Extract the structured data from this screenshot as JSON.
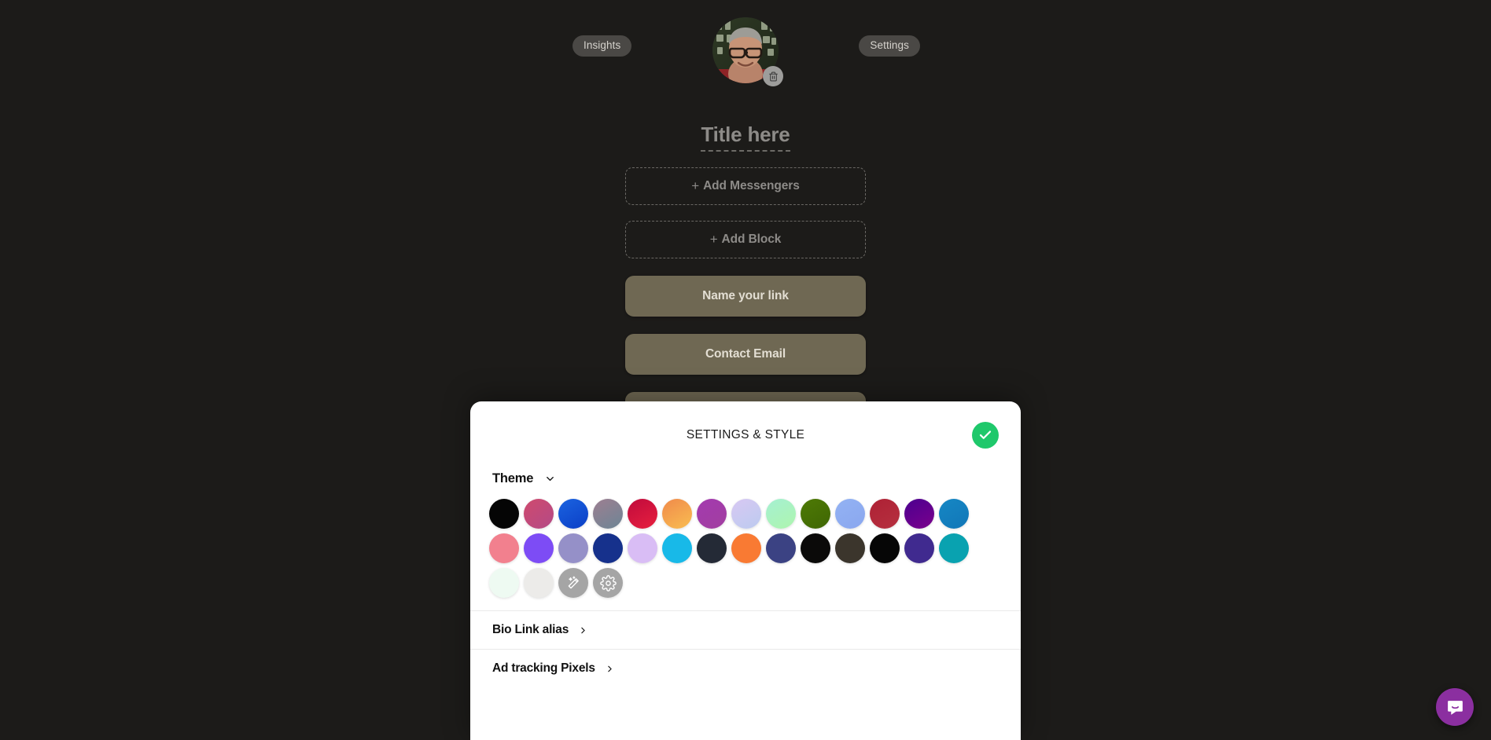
{
  "page": {
    "background_color": "#1c1b19",
    "insights_button": "Insights",
    "settings_button": "Settings",
    "avatar_name": "profile-photo",
    "delete_avatar_icon": "trash-icon",
    "title_placeholder": "Title here",
    "add_messengers": "Add Messengers",
    "add_block": "Add Block",
    "plus": "+",
    "link_buttons": [
      {
        "label": "Name your link"
      },
      {
        "label": "Contact Email"
      },
      {
        "label": ""
      }
    ],
    "link_button_color": "#6f6853"
  },
  "sheet": {
    "title": "SETTINGS & STYLE",
    "done_icon": "check-icon",
    "done_color": "#1fc86b",
    "theme": {
      "label": "Theme",
      "chevron": "chevron-down-icon"
    },
    "swatches": [
      {
        "name": "black",
        "css": "#050505"
      },
      {
        "name": "rose-magenta",
        "css": "linear-gradient(140deg,#cf4a6e 0%,#b44a86 100%)"
      },
      {
        "name": "royal-blue",
        "css": "linear-gradient(150deg,#1b63e0 0%,#0b3fc6 100%)"
      },
      {
        "name": "mauve-steel",
        "css": "linear-gradient(150deg,#9d7f91 0%,#6d8595 100%)"
      },
      {
        "name": "crimson",
        "css": "linear-gradient(150deg,#c00a3c 0%,#e7203f 100%)"
      },
      {
        "name": "orange-amber",
        "css": "linear-gradient(150deg,#f08a4b 0%,#f9bd51 100%)"
      },
      {
        "name": "purple-orchid",
        "css": "linear-gradient(150deg,#a33aaf 0%,#a23fa0 100%)"
      },
      {
        "name": "lavender-pastel",
        "css": "linear-gradient(150deg,#d8c8f2 0%,#bccbf0 100%)"
      },
      {
        "name": "mint-pastel",
        "css": "linear-gradient(150deg,#a5f0d2 0%,#aef5ae 100%)"
      },
      {
        "name": "olive-green",
        "css": "linear-gradient(150deg,#4e7a05 0%,#3f6604 100%)"
      },
      {
        "name": "periwinkle",
        "css": "linear-gradient(150deg,#93b2f3 0%,#8aa7ef 100%)"
      },
      {
        "name": "brick-red",
        "css": "linear-gradient(150deg,#ae2135 0%,#b6303f 100%)"
      },
      {
        "name": "deep-violet",
        "css": "linear-gradient(150deg,#4b0090 0%,#7b008c 100%)"
      },
      {
        "name": "ocean-blue",
        "css": "linear-gradient(150deg,#1687c4 0%,#1177b8 100%)"
      },
      {
        "name": "salmon-pink",
        "css": "#f2808e"
      },
      {
        "name": "violet-indigo",
        "css": "#7d4cf5"
      },
      {
        "name": "muted-purple",
        "css": "#9590c8"
      },
      {
        "name": "navy-blue",
        "css": "#16318c"
      },
      {
        "name": "light-lilac",
        "css": "#d9bdf5"
      },
      {
        "name": "cyan-sky",
        "css": "#18b9e8"
      },
      {
        "name": "charcoal-navy",
        "css": "#242a36"
      },
      {
        "name": "bright-orange",
        "css": "#f97a33"
      },
      {
        "name": "slate-indigo",
        "css": "#3b4283"
      },
      {
        "name": "near-black",
        "css": "#0b0a09"
      },
      {
        "name": "dark-olive-brown",
        "css": "#3b352c"
      },
      {
        "name": "pure-black",
        "css": "#060606"
      },
      {
        "name": "indigo-purple",
        "css": "#402a8f"
      },
      {
        "name": "teal",
        "css": "#09a2b0"
      },
      {
        "name": "mint-white",
        "css": "#eefaf2"
      },
      {
        "name": "off-white",
        "css": "#ecebe9"
      }
    ],
    "action_swatches": [
      {
        "name": "magic-wand-icon",
        "css": "#a5a5a5",
        "icon": "magic-wand-icon"
      },
      {
        "name": "gear-icon",
        "css": "#a5a5a5",
        "icon": "gear-icon"
      }
    ],
    "rows": [
      {
        "label": "Bio Link alias",
        "chevron": "chevron-right-icon"
      },
      {
        "label": "Ad tracking Pixels",
        "chevron": "chevron-right-icon"
      }
    ]
  },
  "launcher": {
    "name": "intercom-chat-launcher",
    "icon": "chat-bubble-icon",
    "color": "#8b2fa0"
  }
}
